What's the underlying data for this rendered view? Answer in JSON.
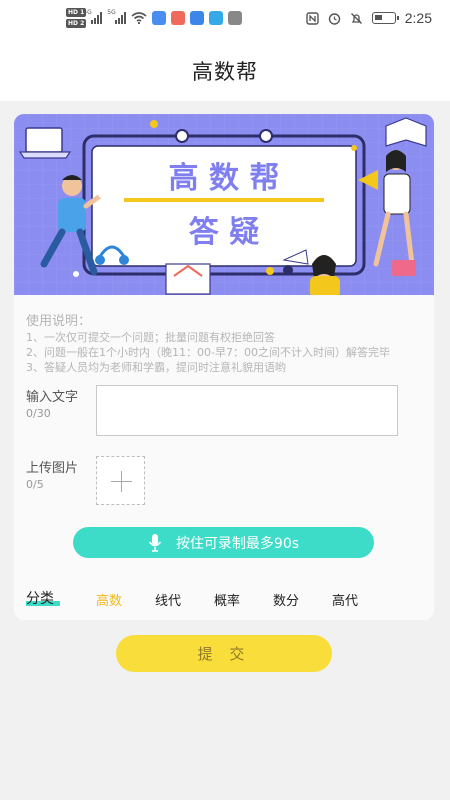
{
  "status_bar": {
    "time": "2:25",
    "hd1": "HD 1",
    "hd2": "HD 2",
    "net1": "4G",
    "net2": "5G"
  },
  "header": {
    "title": "高数帮"
  },
  "banner": {
    "line1": "高 数 帮",
    "line2": "答 疑"
  },
  "instructions": {
    "heading": "使用说明：",
    "items": [
      "1、一次仅可提交一个问题；批量问题有权拒绝回答",
      "2、问题一般在1个小时内（晚11：00-早7：00之间不计入时间）解答完毕",
      "3、答疑人员均为老师和学霸，提问时注意礼貌用语哟"
    ]
  },
  "text_input": {
    "label": "输入文字",
    "count": "0/30",
    "value": ""
  },
  "image_upload": {
    "label": "上传图片",
    "count": "0/5"
  },
  "voice_button": {
    "label": "按住可录制最多90s"
  },
  "category": {
    "label": "分类",
    "tabs": [
      "高数",
      "线代",
      "概率",
      "数分",
      "高代"
    ],
    "active_index": 0
  },
  "submit_label": "提 交",
  "colors": {
    "accent_teal": "#3ddcc8",
    "accent_yellow": "#f9dd3b",
    "active_tab": "#f2b91a",
    "banner_bg": "#8c8df0"
  }
}
